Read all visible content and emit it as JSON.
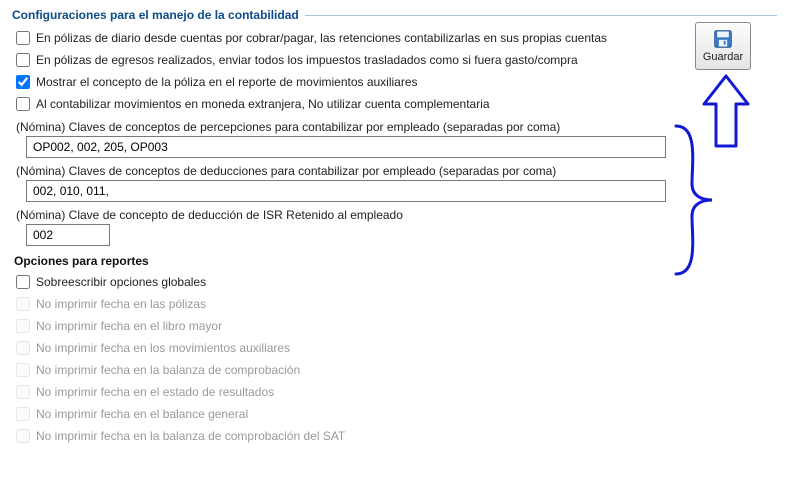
{
  "group": {
    "title": "Configuraciones para el manejo de la contabilidad"
  },
  "checks": {
    "c1": "En pólizas de diario desde cuentas por cobrar/pagar, las retenciones contabilizarlas en sus propias cuentas",
    "c2": "En pólizas de egresos realizados, enviar todos los impuestos trasladados como si fuera gasto/compra",
    "c3": "Mostrar el concepto de la póliza en el reporte de movimientos auxiliares",
    "c4": "Al contabilizar movimientos en moneda extranjera, No utilizar cuenta complementaria"
  },
  "nomina": {
    "perc_label": "(Nómina) Claves de conceptos de percepciones para contabilizar por empleado (separadas por coma)",
    "perc_value": "OP002, 002, 205, OP003",
    "ded_label": "(Nómina) Claves de conceptos de deducciones para contabilizar por empleado (separadas por coma)",
    "ded_value": "002, 010, 011,",
    "isr_label": "(Nómina) Clave de concepto de deducción de ISR Retenido al empleado",
    "isr_value": "002"
  },
  "reports": {
    "title": "Opciones para reportes",
    "r0": "Sobreescribir opciones globales",
    "r1": "No imprimir fecha en las pólizas",
    "r2": "No imprimir fecha en el libro mayor",
    "r3": "No imprimir fecha en los movimientos auxiliares",
    "r4": "No imprimir fecha en la balanza de comprobación",
    "r5": "No imprimir fecha en el estado de resultados",
    "r6": "No imprimir fecha en el balance general",
    "r7": "No imprimir fecha en la balanza de comprobación del SAT"
  },
  "save": {
    "label": "Guardar"
  }
}
